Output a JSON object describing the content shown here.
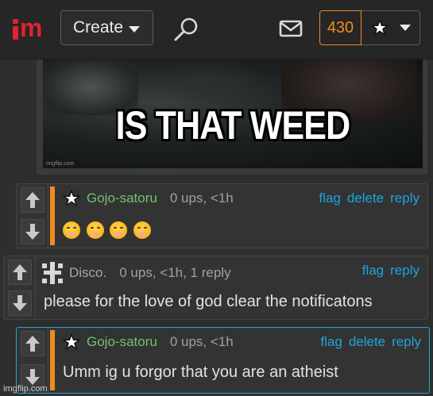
{
  "header": {
    "logo_text": "m",
    "create_label": "Create",
    "notification_count": "430",
    "accent_color": "#f08a24",
    "brand_color": "#e0232f"
  },
  "meme": {
    "caption": "IS THAT WEED",
    "watermark": "imgflip.com"
  },
  "comments": [
    {
      "username": "Gojo-satoru",
      "meta": "0 ups, <1h",
      "body_emoji": [
        "shushing-face",
        "shushing-face",
        "shushing-face",
        "shushing-face"
      ],
      "actions": [
        "flag",
        "delete",
        "reply"
      ]
    },
    {
      "username": "Disco.",
      "meta": "0 ups, <1h, 1 reply",
      "body": "please for the love of god clear the notificatons",
      "actions": [
        "flag",
        "reply"
      ]
    },
    {
      "username": "Gojo-satoru",
      "meta": "0 ups, <1h",
      "body": "Umm ig u forgor that you are an atheist",
      "actions": [
        "flag",
        "delete",
        "reply"
      ]
    }
  ],
  "footer": {
    "watermark": "imgflip.com"
  },
  "colors": {
    "link": "#1ea4dc",
    "username_green": "#73c16a",
    "highlight_border": "#1aa8d8"
  }
}
